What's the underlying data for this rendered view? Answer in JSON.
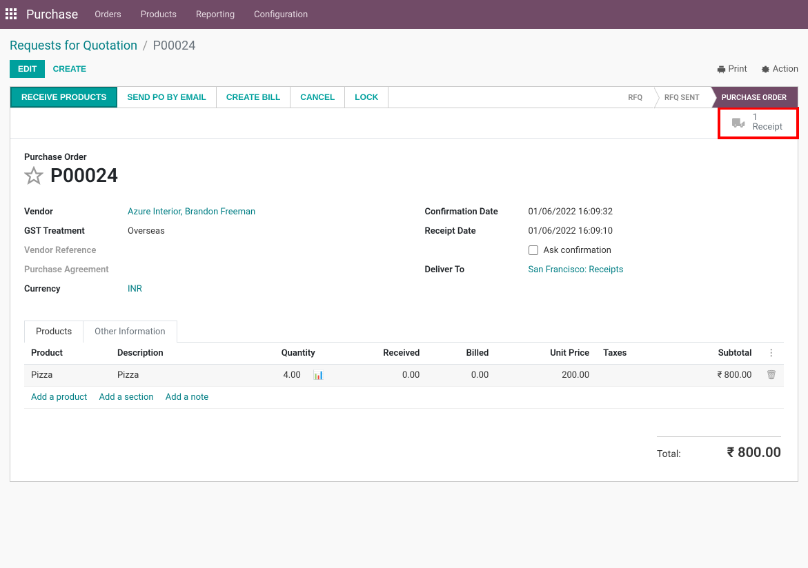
{
  "topbar": {
    "app_name": "Purchase",
    "menu": [
      "Orders",
      "Products",
      "Reporting",
      "Configuration"
    ]
  },
  "breadcrumb": {
    "parent": "Requests for Quotation",
    "current": "P00024"
  },
  "controls": {
    "edit": "EDIT",
    "create": "CREATE",
    "print": "Print",
    "action": "Action"
  },
  "statusbar": {
    "buttons": [
      "RECEIVE PRODUCTS",
      "SEND PO BY EMAIL",
      "CREATE BILL",
      "CANCEL",
      "LOCK"
    ],
    "stages": [
      "RFQ",
      "RFQ SENT",
      "PURCHASE ORDER"
    ]
  },
  "stat_button": {
    "count": "1",
    "label": "Receipt"
  },
  "header": {
    "type_label": "Purchase Order",
    "title": "P00024"
  },
  "fields_left": {
    "vendor_label": "Vendor",
    "vendor_value": "Azure Interior, Brandon Freeman",
    "gst_label": "GST Treatment",
    "gst_value": "Overseas",
    "vendor_ref_label": "Vendor Reference",
    "purchase_agreement_label": "Purchase Agreement",
    "currency_label": "Currency",
    "currency_value": "INR"
  },
  "fields_right": {
    "confirmation_label": "Confirmation Date",
    "confirmation_value": "01/06/2022 16:09:32",
    "receipt_label": "Receipt Date",
    "receipt_value": "01/06/2022 16:09:10",
    "ask_confirmation": "Ask confirmation",
    "deliver_to_label": "Deliver To",
    "deliver_to_value": "San Francisco: Receipts"
  },
  "tabs": {
    "products": "Products",
    "other": "Other Information"
  },
  "table": {
    "headers": {
      "product": "Product",
      "description": "Description",
      "quantity": "Quantity",
      "received": "Received",
      "billed": "Billed",
      "unit_price": "Unit Price",
      "taxes": "Taxes",
      "subtotal": "Subtotal"
    },
    "rows": [
      {
        "product": "Pizza",
        "description": "Pizza",
        "quantity": "4.00",
        "received": "0.00",
        "billed": "0.00",
        "unit_price": "200.00",
        "taxes": "",
        "subtotal": "₹ 800.00"
      }
    ],
    "add_product": "Add a product",
    "add_section": "Add a section",
    "add_note": "Add a note"
  },
  "totals": {
    "label": "Total:",
    "value": "₹ 800.00"
  }
}
